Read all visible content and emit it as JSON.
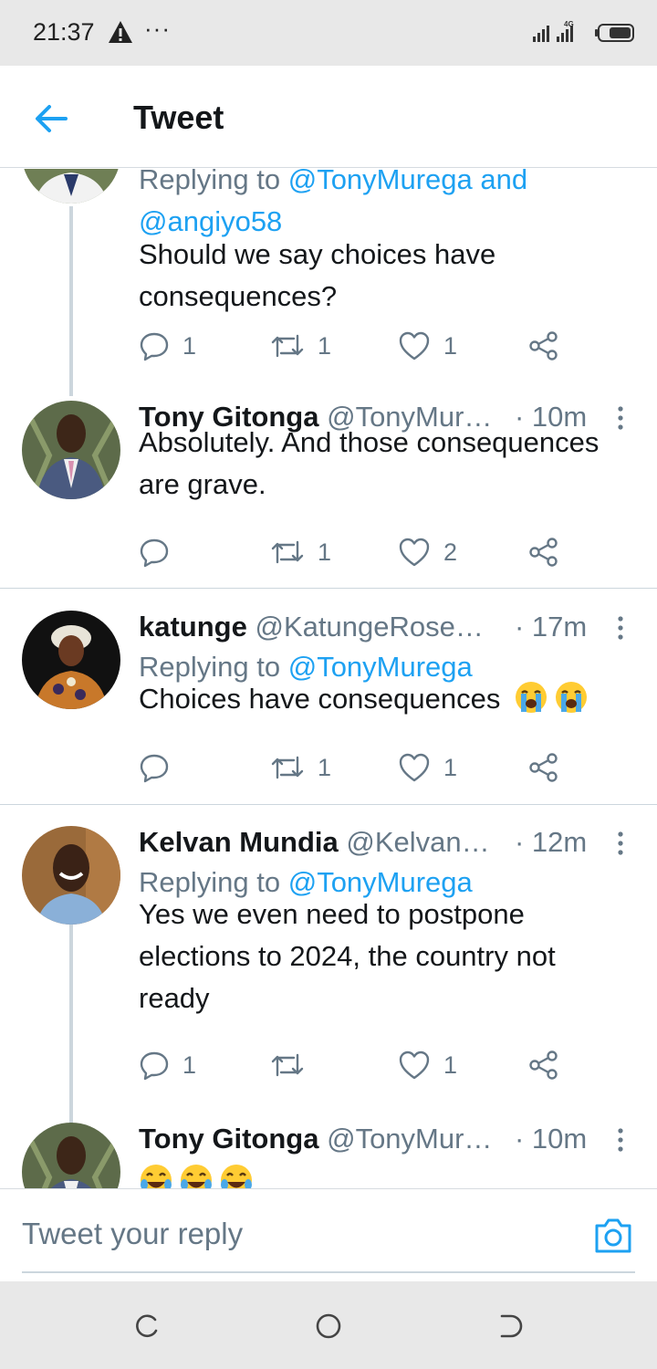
{
  "status_bar": {
    "time": "21:37",
    "dots": "···",
    "network": "4G"
  },
  "header": {
    "title": "Tweet"
  },
  "tweets": [
    {
      "replying_prefix": "Replying to ",
      "replying_to_1": "@TonyMurega",
      "replying_and": " and",
      "replying_to_2": "@angiyo58",
      "text": "Should we say choices have consequences?",
      "reply_count": "1",
      "retweet_count": "1",
      "like_count": "1"
    },
    {
      "name": "Tony Gitonga",
      "handle": "@TonyMur…",
      "time": "· 10m",
      "text": "Absolutely. And those consequences are grave.",
      "reply_count": "",
      "retweet_count": "1",
      "like_count": "2"
    },
    {
      "name": "katunge",
      "handle": "@KatungeRose…",
      "time": "· 17m",
      "replying_prefix": "Replying to ",
      "replying_to": "@TonyMurega",
      "text": "Choices have consequences",
      "emoji": [
        "loudly-crying-face",
        "loudly-crying-face"
      ],
      "reply_count": "",
      "retweet_count": "1",
      "like_count": "1"
    },
    {
      "name": "Kelvan Mundia",
      "handle": "@Kelvan…",
      "time": "· 12m",
      "replying_prefix": "Replying to ",
      "replying_to": "@TonyMurega",
      "text": "Yes we even need to postpone elections to 2024, the country not ready",
      "reply_count": "1",
      "retweet_count": "",
      "like_count": "1"
    },
    {
      "name": "Tony Gitonga",
      "handle": "@TonyMur…",
      "time": "· 10m",
      "emoji": [
        "face-with-tears-of-joy",
        "face-with-tears-of-joy",
        "face-with-tears-of-joy"
      ]
    }
  ],
  "reply_bar": {
    "placeholder": "Tweet your reply"
  },
  "colors": {
    "accent": "#1da1f2",
    "text": "#14171a",
    "secondary": "#657786",
    "divider": "#ccd6dd"
  }
}
